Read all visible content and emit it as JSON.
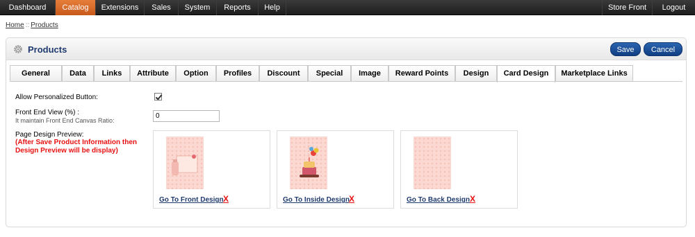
{
  "nav": {
    "items": [
      "Dashboard",
      "Catalog",
      "Extensions",
      "Sales",
      "System",
      "Reports",
      "Help"
    ],
    "active": "Catalog",
    "right": [
      "Store Front",
      "Logout"
    ]
  },
  "breadcrumb": {
    "home": "Home",
    "sep": "::",
    "current": "Products"
  },
  "header": {
    "title": "Products",
    "save_label": "Save",
    "cancel_label": "Cancel",
    "gear_icon": "gear-icon"
  },
  "tabs": [
    "General",
    "Data",
    "Links",
    "Attribute",
    "Option",
    "Profiles",
    "Discount",
    "Special",
    "Image",
    "Reward Points",
    "Design",
    "Card Design",
    "Marketplace Links"
  ],
  "active_tab": "Card Design",
  "form": {
    "personalized_label": "Allow Personalized Button:",
    "personalized_checked": true,
    "front_view_label": "Front End View (%) :",
    "front_view_sublabel": "It maintain Front End Canvas Ratio:",
    "front_view_value": "0",
    "preview_label": "Page Design Preview:",
    "preview_note": "(After Save Product Information then Design Preview will be display)"
  },
  "designs": [
    {
      "link": "Go To Front Design",
      "remove": "X"
    },
    {
      "link": "Go To Inside Design",
      "remove": "X"
    },
    {
      "link": "Go To Back Design",
      "remove": "X"
    }
  ],
  "colors": {
    "accent": "#1f3a6e",
    "nav_active": "#d8692a",
    "warning": "#e81010",
    "button": "#1a4f9a"
  }
}
